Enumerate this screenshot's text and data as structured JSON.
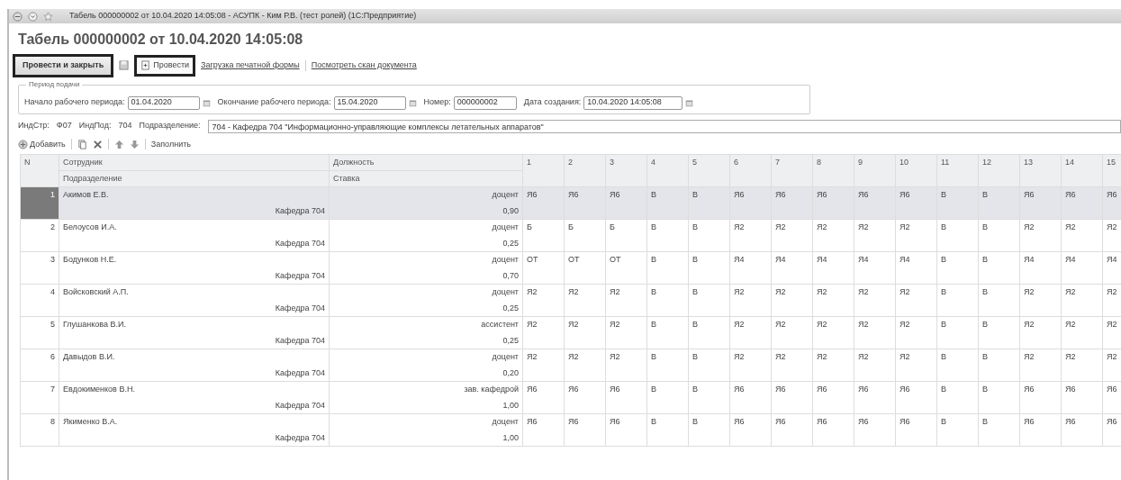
{
  "window": {
    "title": "Табель 000000002 от 10.04.2020 14:05:08 - АСУПК - Ким Р.В. (тест ролей)  (1С:Предприятие)"
  },
  "document_title": "Табель 000000002 от 10.04.2020 14:05:08",
  "command_bar": {
    "post_and_close": "Провести и закрыть",
    "post": "Провести",
    "links": [
      "Загрузка печатной формы",
      "Посмотреть скан документа"
    ]
  },
  "period_group": {
    "title": "Период подачи",
    "fields": [
      {
        "kind": "date",
        "label": "Начало рабочего периода:",
        "value": "01.04.2020"
      },
      {
        "kind": "date",
        "label": "Окончание рабочего периода:",
        "value": "15.04.2020"
      },
      {
        "kind": "text",
        "label": "Номер:",
        "value": "000000002"
      },
      {
        "kind": "date",
        "label": "Дата создания:",
        "value": "10.04.2020 14:05:08"
      }
    ]
  },
  "info": {
    "items": [
      {
        "label": "ИндСтр:",
        "value": "Ф07"
      },
      {
        "label": "ИндПод:",
        "value": "704"
      }
    ],
    "department_label": "Подразделение:",
    "department_value": "704 - Кафедра 704 \"Информационно-управляющие комплексы летательных аппаратов\""
  },
  "table_toolbar": {
    "add": "Добавить",
    "fill": "Заполнить"
  },
  "table": {
    "columns": {
      "n": "N",
      "employee": "Сотрудник",
      "department": "Подразделение",
      "position": "Должность",
      "rate": "Ставка",
      "days": [
        "1",
        "2",
        "3",
        "4",
        "5",
        "6",
        "7",
        "8",
        "9",
        "10",
        "11",
        "12",
        "13",
        "14",
        "15"
      ]
    },
    "rows": [
      {
        "n": "1",
        "employee": "Акимов Е.В.",
        "department": "Кафедра 704",
        "position": "доцент",
        "rate": "0,90",
        "selected": true,
        "days": [
          "Я6",
          "Я6",
          "Я6",
          "В",
          "В",
          "Я6",
          "Я6",
          "Я6",
          "Я6",
          "Я6",
          "В",
          "В",
          "Я6",
          "Я6",
          "Я6"
        ]
      },
      {
        "n": "2",
        "employee": "Белоусов И.А.",
        "department": "Кафедра 704",
        "position": "доцент",
        "rate": "0,25",
        "selected": false,
        "days": [
          "Б",
          "Б",
          "Б",
          "В",
          "В",
          "Я2",
          "Я2",
          "Я2",
          "Я2",
          "Я2",
          "В",
          "В",
          "Я2",
          "Я2",
          "Я2"
        ]
      },
      {
        "n": "3",
        "employee": "Бодунков Н.Е.",
        "department": "Кафедра 704",
        "position": "доцент",
        "rate": "0,70",
        "selected": false,
        "days": [
          "ОТ",
          "ОТ",
          "ОТ",
          "В",
          "В",
          "Я4",
          "Я4",
          "Я4",
          "Я4",
          "Я4",
          "В",
          "В",
          "Я4",
          "Я4",
          "Я4"
        ]
      },
      {
        "n": "4",
        "employee": "Войсковский А.П.",
        "department": "Кафедра 704",
        "position": "доцент",
        "rate": "0,25",
        "selected": false,
        "days": [
          "Я2",
          "Я2",
          "Я2",
          "В",
          "В",
          "Я2",
          "Я2",
          "Я2",
          "Я2",
          "Я2",
          "В",
          "В",
          "Я2",
          "Я2",
          "Я2"
        ]
      },
      {
        "n": "5",
        "employee": "Глушанкова В.И.",
        "department": "Кафедра 704",
        "position": "ассистент",
        "rate": "0,25",
        "selected": false,
        "days": [
          "Я2",
          "Я2",
          "Я2",
          "В",
          "В",
          "Я2",
          "Я2",
          "Я2",
          "Я2",
          "Я2",
          "В",
          "В",
          "Я2",
          "Я2",
          "Я2"
        ]
      },
      {
        "n": "6",
        "employee": "Давыдов В.И.",
        "department": "Кафедра 704",
        "position": "доцент",
        "rate": "0,20",
        "selected": false,
        "days": [
          "Я2",
          "Я2",
          "Я2",
          "В",
          "В",
          "Я2",
          "Я2",
          "Я2",
          "Я2",
          "Я2",
          "В",
          "В",
          "Я2",
          "Я2",
          "Я2"
        ]
      },
      {
        "n": "7",
        "employee": "Евдокименков В.Н.",
        "department": "Кафедра 704",
        "position": "зав. кафедрой",
        "rate": "1,00",
        "selected": false,
        "days": [
          "Я6",
          "Я6",
          "Я6",
          "В",
          "В",
          "Я6",
          "Я6",
          "Я6",
          "Я6",
          "Я6",
          "В",
          "В",
          "Я6",
          "Я6",
          "Я6"
        ]
      },
      {
        "n": "8",
        "employee": "Якименко В.А.",
        "department": "Кафедра 704",
        "position": "доцент",
        "rate": "1,00",
        "selected": false,
        "days": [
          "Я6",
          "Я6",
          "Я6",
          "В",
          "В",
          "Я6",
          "Я6",
          "Я6",
          "Я6",
          "Я6",
          "В",
          "В",
          "Я6",
          "Я6",
          "Я6"
        ]
      }
    ]
  }
}
